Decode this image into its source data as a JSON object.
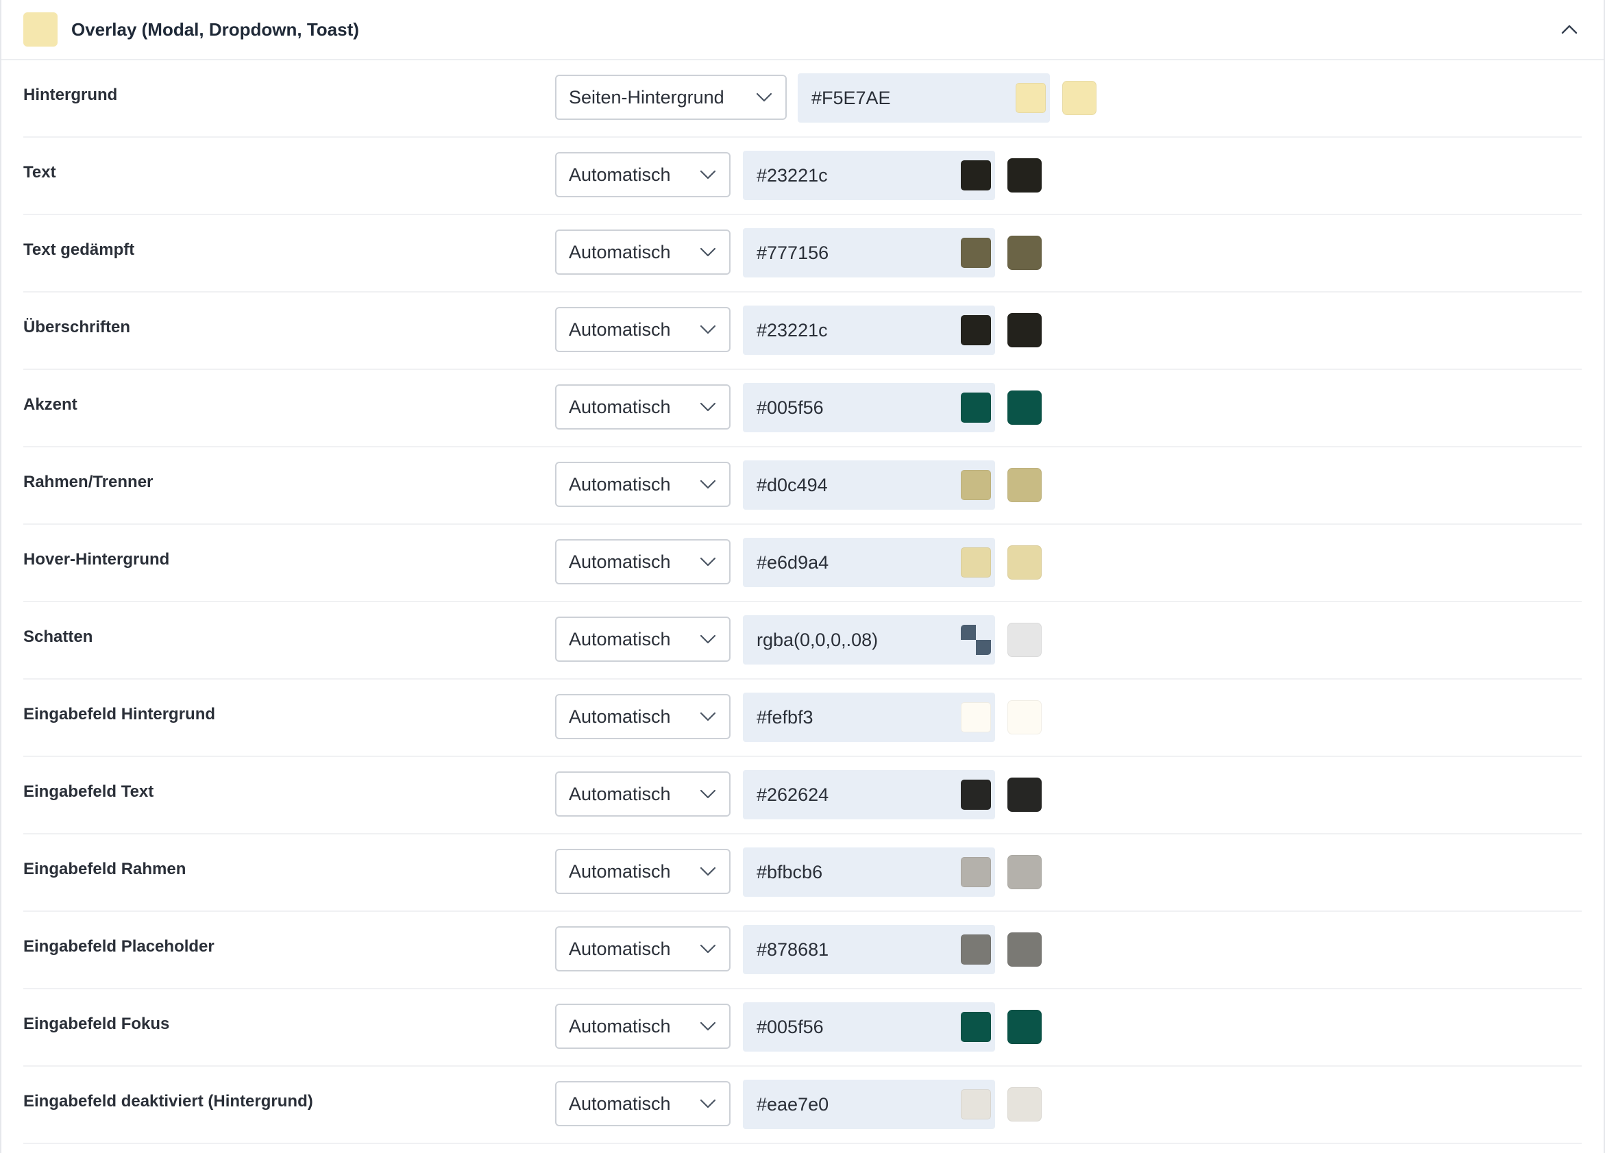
{
  "section": {
    "title": "Overlay (Modal, Dropdown, Toast)",
    "swatch_color": "#F5E7AE",
    "collapse_icon": "chevron-up-icon"
  },
  "rows": [
    {
      "label": "Hintergrund",
      "mode": "Seiten-Hintergrund",
      "value": "#F5E7AE",
      "color": "#F5E7AE"
    },
    {
      "label": "Text",
      "mode": "Automatisch",
      "value": "#23221c",
      "color": "#23221c"
    },
    {
      "label": "Text gedämpft",
      "mode": "Automatisch",
      "value": "#777156",
      "color": "#6b6446"
    },
    {
      "label": "Überschriften",
      "mode": "Automatisch",
      "value": "#23221c",
      "color": "#23221c"
    },
    {
      "label": "Akzent",
      "mode": "Automatisch",
      "value": "#005f56",
      "color": "#0a5448"
    },
    {
      "label": "Rahmen/Trenner",
      "mode": "Automatisch",
      "value": "#d0c494",
      "color": "#c8bb84"
    },
    {
      "label": "Hover-Hintergrund",
      "mode": "Automatisch",
      "value": "#e6d9a4",
      "color": "#e6d9a4"
    },
    {
      "label": "Schatten",
      "mode": "Automatisch",
      "value": "rgba(0,0,0,.08)",
      "color": "#e6e6e6",
      "checker": true
    },
    {
      "label": "Eingabefeld Hintergrund",
      "mode": "Automatisch",
      "value": "#fefbf3",
      "color": "#fefbf3"
    },
    {
      "label": "Eingabefeld Text",
      "mode": "Automatisch",
      "value": "#262624",
      "color": "#262624"
    },
    {
      "label": "Eingabefeld Rahmen",
      "mode": "Automatisch",
      "value": "#bfbcb6",
      "color": "#b4b1ab"
    },
    {
      "label": "Eingabefeld Placeholder",
      "mode": "Automatisch",
      "value": "#878681",
      "color": "#7a7974"
    },
    {
      "label": "Eingabefeld Fokus",
      "mode": "Automatisch",
      "value": "#005f56",
      "color": "#0a5448"
    },
    {
      "label": "Eingabefeld deaktiviert (Hintergrund)",
      "mode": "Automatisch",
      "value": "#eae7e0",
      "color": "#e6e3dc"
    }
  ]
}
